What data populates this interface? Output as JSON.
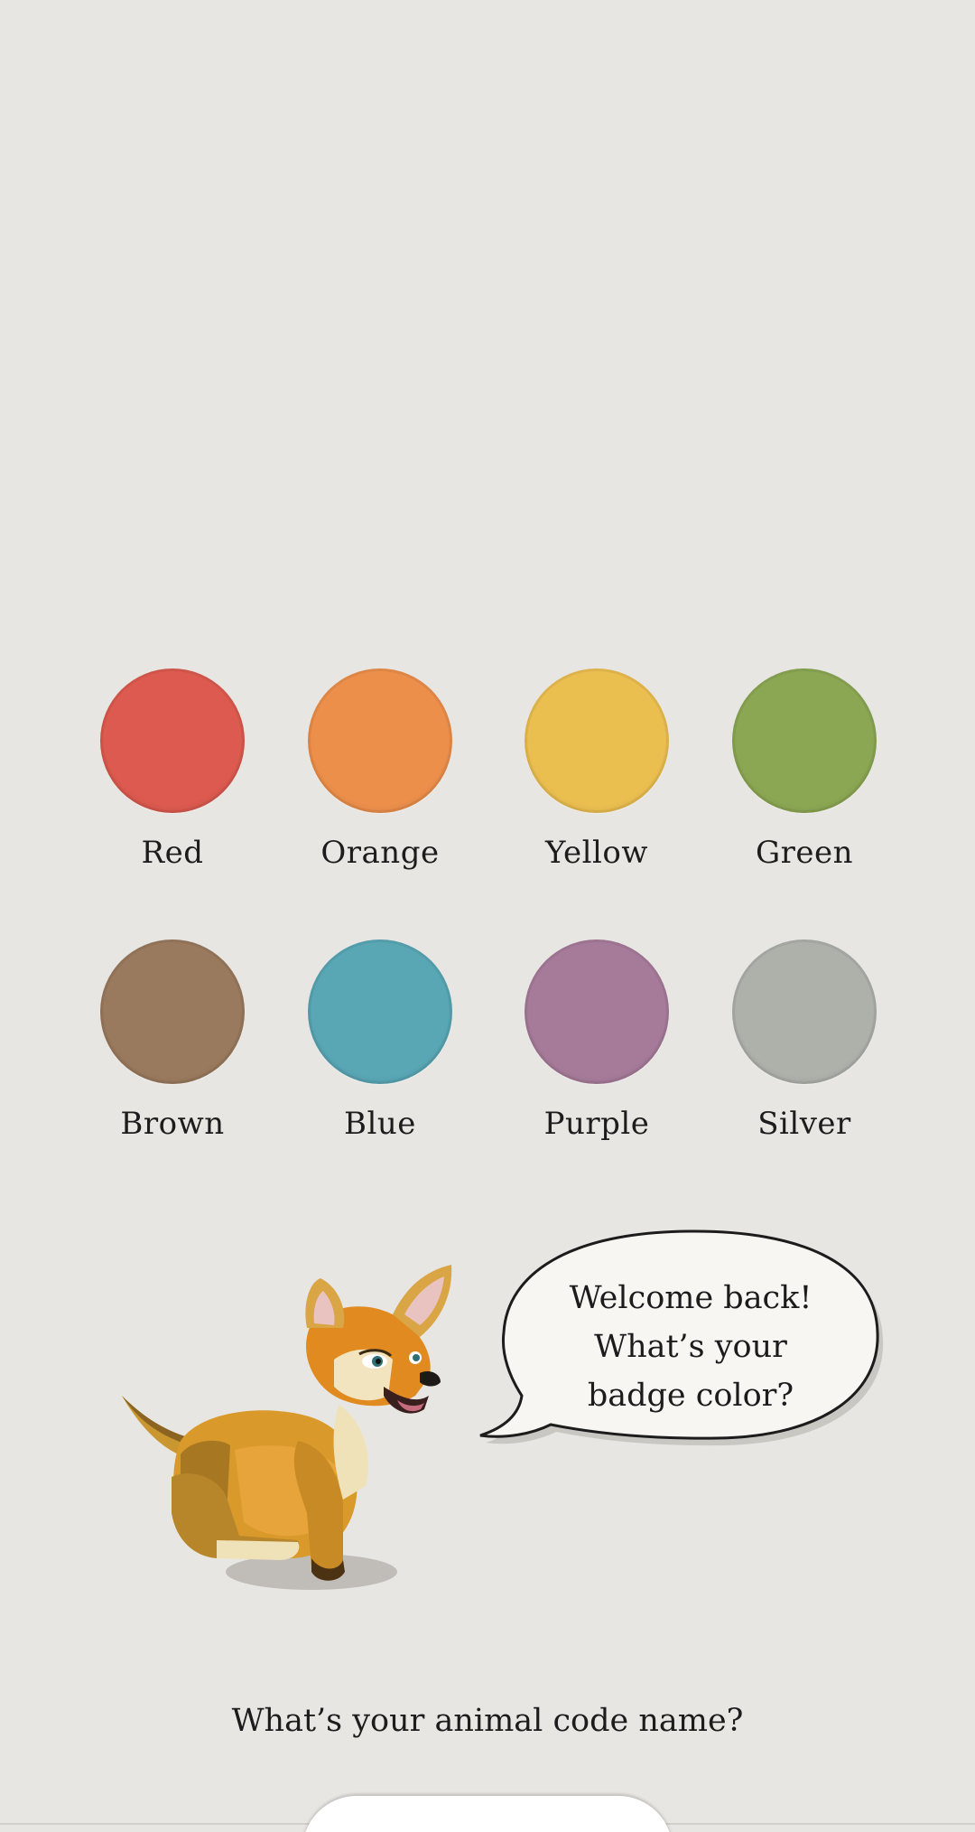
{
  "swatches": [
    {
      "label": "Red",
      "color": "#dc5a4f"
    },
    {
      "label": "Orange",
      "color": "#ec8f4b"
    },
    {
      "label": "Yellow",
      "color": "#ebbe50"
    },
    {
      "label": "Green",
      "color": "#8ba753"
    },
    {
      "label": "Brown",
      "color": "#9a7a5e"
    },
    {
      "label": "Blue",
      "color": "#59a6b5"
    },
    {
      "label": "Purple",
      "color": "#a67b9a"
    },
    {
      "label": "Silver",
      "color": "#aeb1aa"
    }
  ],
  "bubble": {
    "line1": "Welcome back!",
    "line2": "What’s your",
    "line3": "badge color?"
  },
  "prompt": "What’s your animal code name?",
  "mascot": {
    "icon": "fox-mascot-icon"
  },
  "colors": {
    "background": "#e8e6e2",
    "bubble_fill": "#f7f6f3"
  }
}
